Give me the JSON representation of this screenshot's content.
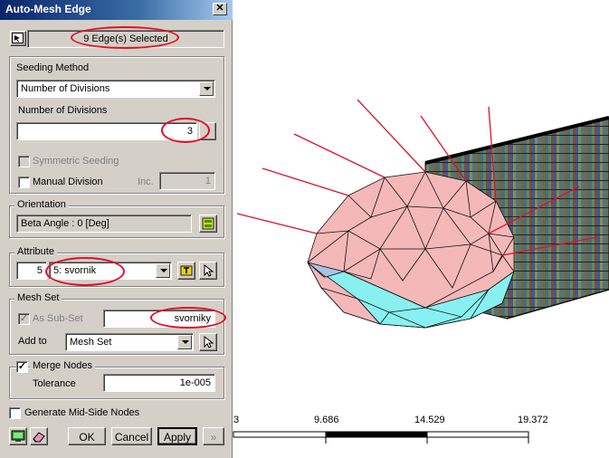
{
  "dialog": {
    "title": "Auto-Mesh Edge",
    "selection_text": "9 Edge(s) Selected",
    "seeding": {
      "group_label": "Seeding Method",
      "method_value": "Number of Divisions",
      "divisions_label": "Number of Divisions",
      "divisions_value": "3",
      "symmetric_label": "Symmetric Seeding",
      "manual_label": "Manual Division",
      "inc_label": "Inc.",
      "inc_value": "1"
    },
    "orientation": {
      "group_label": "Orientation",
      "value": "Beta Angle : 0 [Deg]"
    },
    "attribute": {
      "group_label": "Attribute",
      "id_value": "5",
      "selected": "5: svornik"
    },
    "mesh_set": {
      "group_label": "Mesh Set",
      "sub_set_label": "As Sub-Set",
      "sub_set_value": "svorniky",
      "add_to_label": "Add to",
      "add_to_value": "Mesh Set"
    },
    "merge": {
      "label": "Merge Nodes",
      "tolerance_label": "Tolerance",
      "tolerance_value": "1e-005"
    },
    "mid_side_label": "Generate Mid-Side Nodes",
    "buttons": {
      "ok": "OK",
      "cancel": "Cancel",
      "apply": "Apply",
      "more": "»"
    }
  },
  "scale_bar": {
    "ticks": [
      "3",
      "9.686",
      "14.529",
      "19.372"
    ]
  },
  "colors": {
    "annotation_red": "#e0102a",
    "mesh_pink": "#f4b8b8",
    "mesh_cyan": "#88f0f0",
    "mesh_blue": "#a8c4e8"
  }
}
